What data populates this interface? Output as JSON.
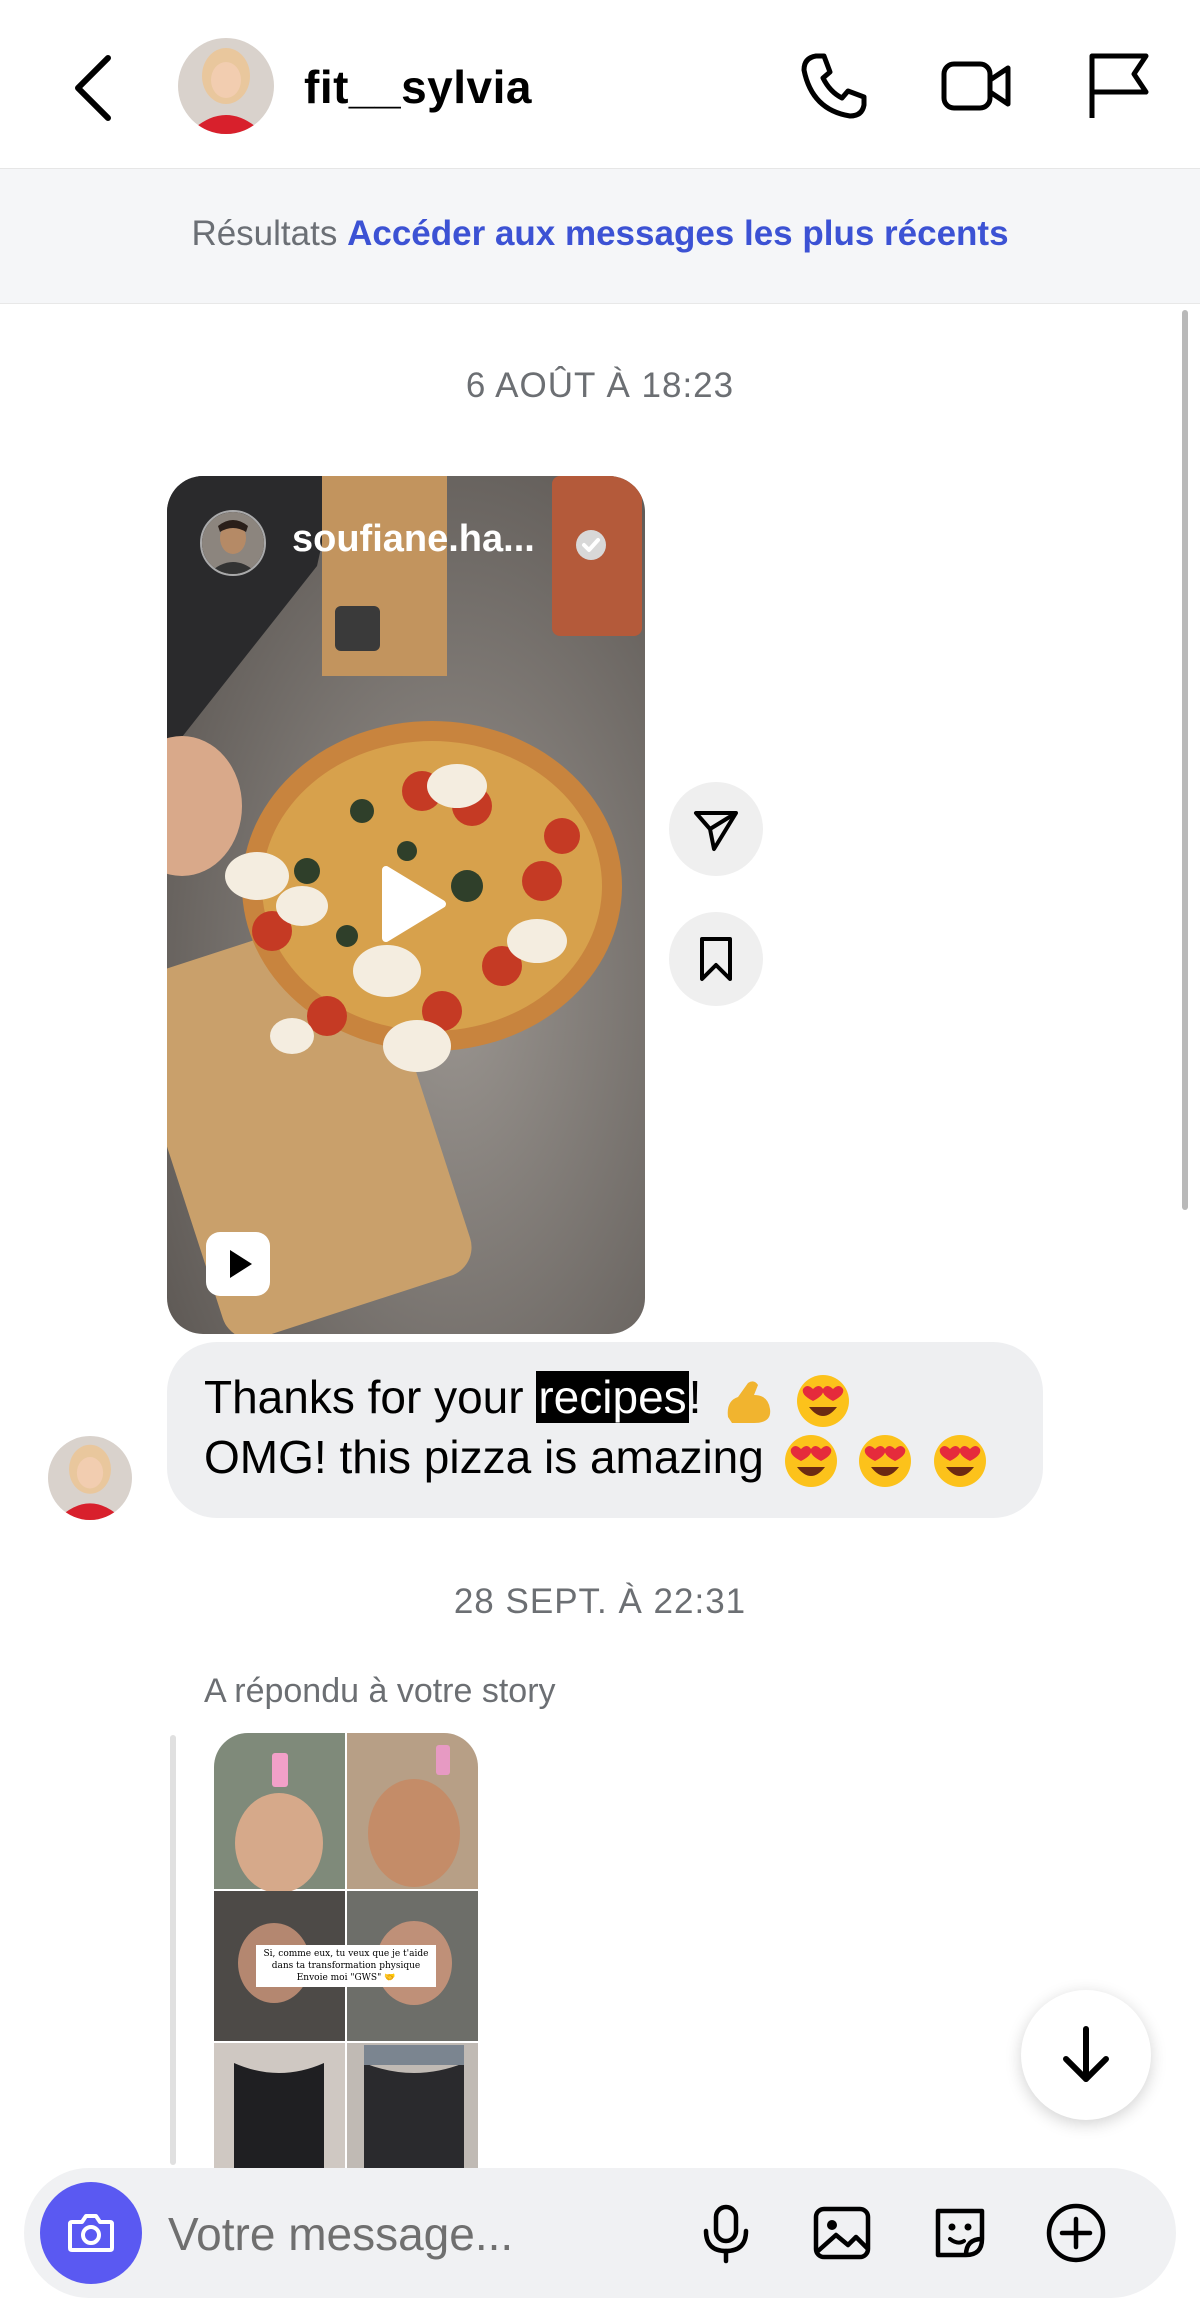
{
  "header": {
    "username": "fit__sylvia",
    "icons": [
      "back-chevron-icon",
      "phone-icon",
      "video-camera-icon",
      "flag-icon"
    ]
  },
  "banner": {
    "prefix": "Résultats",
    "link": "Accéder aux messages les plus récents"
  },
  "thread": {
    "timestamp1": "6 AOÛT À 18:23",
    "reel": {
      "username": "soufiane.ha...",
      "verified": true,
      "actions": [
        "send-icon",
        "bookmark-icon"
      ]
    },
    "message": {
      "line1_before": "Thanks for your ",
      "line1_highlight": "recipes",
      "line1_after": "!",
      "line1_emojis": [
        "flexed-biceps",
        "heart-eyes"
      ],
      "line2": "OMG! this pizza is amazing",
      "line2_emojis": [
        "heart-eyes",
        "heart-eyes",
        "heart-eyes"
      ]
    },
    "timestamp2": "28 SEPT. À 22:31",
    "reply_label": "A répondu à votre story",
    "story": {
      "caption_line1": "Si, comme eux, tu veux que je t'aide",
      "caption_line2": "dans ta transformation physique",
      "caption_line3": "Envoie moi \"GWS\" 🤝"
    }
  },
  "composer": {
    "placeholder": "Votre message...",
    "icons": [
      "camera-icon",
      "microphone-icon",
      "gallery-icon",
      "sticker-icon",
      "plus-circle-icon"
    ]
  },
  "colors": {
    "link": "#3c52d4",
    "camera_button": "#5a59f2",
    "bubble": "#eeeff1"
  }
}
